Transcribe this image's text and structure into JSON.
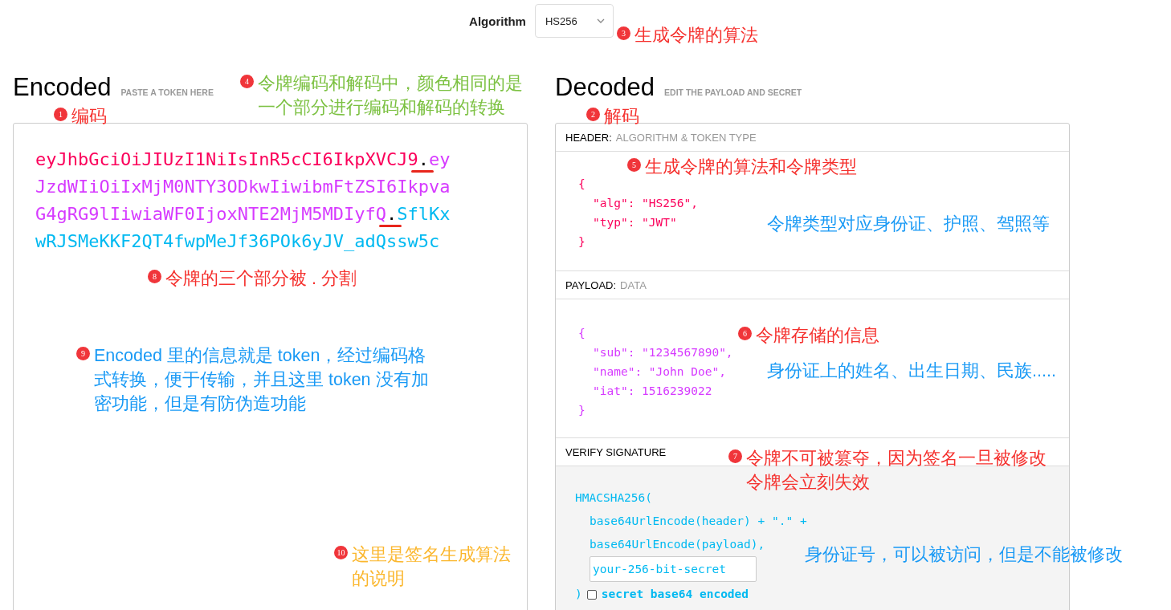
{
  "algorithm": {
    "label": "Algorithm",
    "value": "HS256"
  },
  "encoded": {
    "title": "Encoded",
    "hint": "PASTE A TOKEN HERE",
    "token_lines": [
      [
        {
          "kind": "part",
          "text": "eyJhbGciOiJIUzI1NiIsInR5cCI6IkpXVCJ9",
          "color": "#fb015b"
        },
        {
          "kind": "dot",
          "text": ".",
          "underlined": true
        },
        {
          "kind": "part",
          "text": "ey",
          "color": "#d63aff"
        }
      ],
      [
        {
          "kind": "part",
          "text": "JzdWIiOiIxMjM0NTY3ODkwIiwibmFtZSI6Ikpva",
          "color": "#d63aff"
        }
      ],
      [
        {
          "kind": "part",
          "text": "G4gRG9lIiwiaWF0IjoxNTE2MjM5MDIyfQ",
          "color": "#d63aff"
        },
        {
          "kind": "dot",
          "text": ".",
          "underlined": true
        },
        {
          "kind": "part",
          "text": "SflKx",
          "color": "#00b9f1"
        }
      ],
      [
        {
          "kind": "part",
          "text": "wRJSMeKKF2QT4fwpMeJf36POk6yJV_adQssw5c",
          "color": "#00b9f1"
        }
      ]
    ]
  },
  "decoded": {
    "title": "Decoded",
    "hint": "EDIT THE PAYLOAD AND SECRET",
    "sections": [
      {
        "kind": "json",
        "title": "HEADER:",
        "subtitle": "ALGORITHM & TOKEN TYPE",
        "color": "#fb015b",
        "open": "{",
        "entries": [
          "\"alg\": \"HS256\",",
          "\"typ\": \"JWT\""
        ],
        "close": "}"
      },
      {
        "kind": "json",
        "title": "PAYLOAD:",
        "subtitle": "DATA",
        "color": "#d63aff",
        "open": "{",
        "entries": [
          "\"sub\": \"1234567890\",",
          "\"name\": \"John Doe\",",
          "\"iat\": 1516239022"
        ],
        "close": "}"
      },
      {
        "kind": "signature",
        "title": "VERIFY SIGNATURE",
        "color": "#00b9f1",
        "open": "HMACSHA256(",
        "entries": [
          "base64UrlEncode(header) + \".\" +",
          "base64UrlEncode(payload),"
        ],
        "secret": "your-256-bit-secret",
        "close": ")",
        "checkbox": {
          "label": "secret base64 encoded",
          "checked": false
        }
      }
    ]
  },
  "annotations": [
    {
      "number": "1",
      "text": "编码",
      "color": "#f5312e"
    },
    {
      "number": "2",
      "text": "解码",
      "color": "#f5312e"
    },
    {
      "number": "3",
      "text": "生成令牌的算法",
      "color": "#f5312e"
    },
    {
      "number": "4",
      "text": "令牌编码和解码中，颜色相同的是一个部分进行编码和解码的转换",
      "color": "#7cc142"
    },
    {
      "number": "5",
      "text": "生成令牌的算法和令牌类型",
      "color": "#f5312e"
    },
    {
      "number": "6",
      "text": "令牌存储的信息",
      "color": "#f5312e"
    },
    {
      "number": "7",
      "text": "令牌不可被篡夺，因为签名一旦被修改令牌会立刻失效",
      "color": "#f5312e"
    },
    {
      "number": "8",
      "text": "令牌的三个部分被 . 分割",
      "color": "#f5312e"
    },
    {
      "number": "9",
      "text": "Encoded 里的信息就是 token，经过编码格式转换，便于传输，并且这里 token 没有加密功能，但是有防伪造功能",
      "color": "#1a9af5"
    },
    {
      "number": "10",
      "text": "这里是签名生成算法的说明",
      "color": "#fbb72e"
    },
    {
      "text": "令牌类型对应身份证、护照、驾照等",
      "color": "#1a9af5"
    },
    {
      "text": "身份证上的姓名、出生日期、民族.....",
      "color": "#1a9af5"
    },
    {
      "text": "身份证号，可以被访问，但是不能被修改",
      "color": "#1a9af5"
    }
  ]
}
